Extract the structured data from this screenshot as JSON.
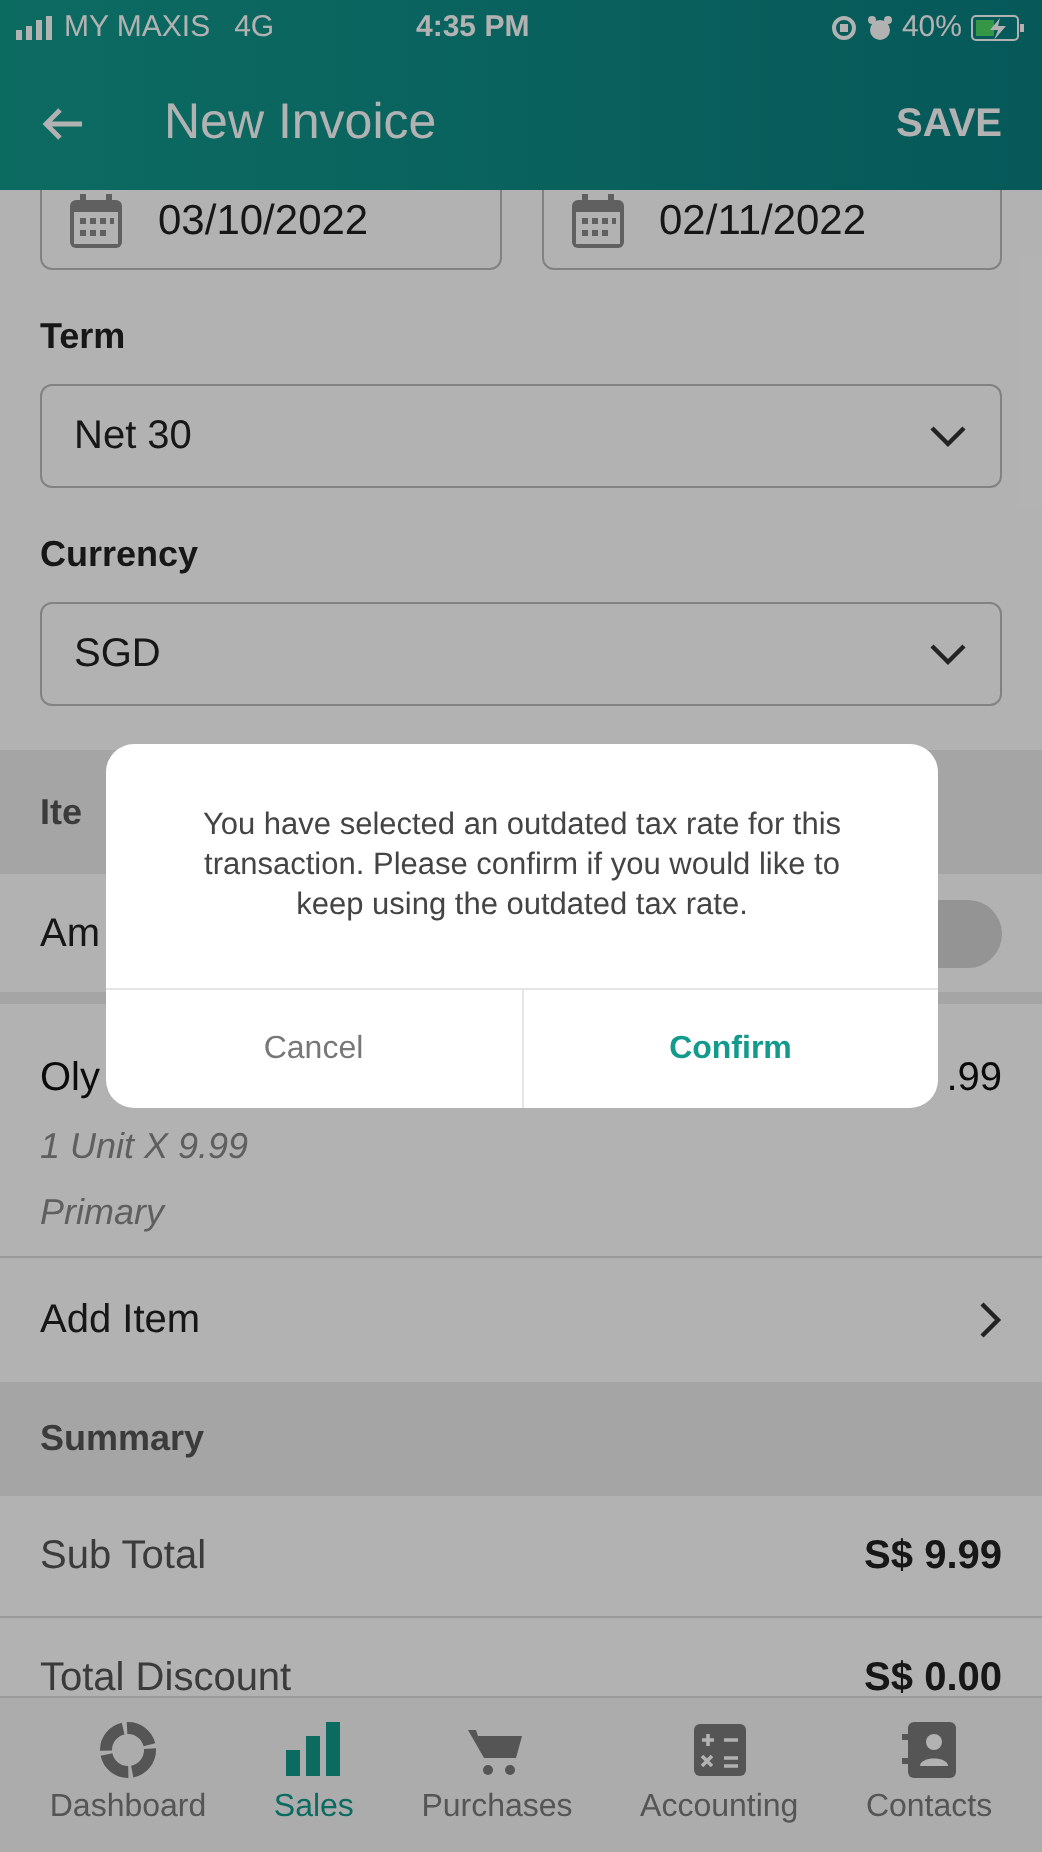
{
  "status_bar": {
    "carrier": "MY MAXIS",
    "network": "4G",
    "time": "4:35 PM",
    "battery": "40%"
  },
  "header": {
    "title": "New Invoice",
    "action": "SAVE"
  },
  "dates": [
    "03/10/2022",
    "02/11/2022"
  ],
  "fields": [
    {
      "label": "Term",
      "value": "Net 30"
    },
    {
      "label": "Currency",
      "value": "SGD"
    }
  ],
  "items_section": {
    "title": "Ite"
  },
  "amount_row": {
    "label": "Am",
    "kind": "toggle",
    "on": false
  },
  "item": {
    "name": "Oly",
    "amount": ".99",
    "detail": "1 Unit X 9.99",
    "account": "Primary"
  },
  "add_item": "Add Item",
  "summary": {
    "title": "Summary",
    "rows": [
      {
        "label": "Sub Total",
        "value": "S$ 9.99"
      },
      {
        "label": "Total Discount",
        "value": "S$ 0.00"
      }
    ]
  },
  "dialog": {
    "message": "You have selected an outdated tax rate for this transaction. Please confirm if you would like to keep using the outdated tax rate.",
    "cancel": "Cancel",
    "confirm": "Confirm"
  },
  "tabs": [
    {
      "label": "Dashboard",
      "selected": false
    },
    {
      "label": "Sales",
      "selected": true
    },
    {
      "label": "Purchases",
      "selected": false
    },
    {
      "label": "Accounting",
      "selected": false
    },
    {
      "label": "Contacts",
      "selected": false
    }
  ]
}
